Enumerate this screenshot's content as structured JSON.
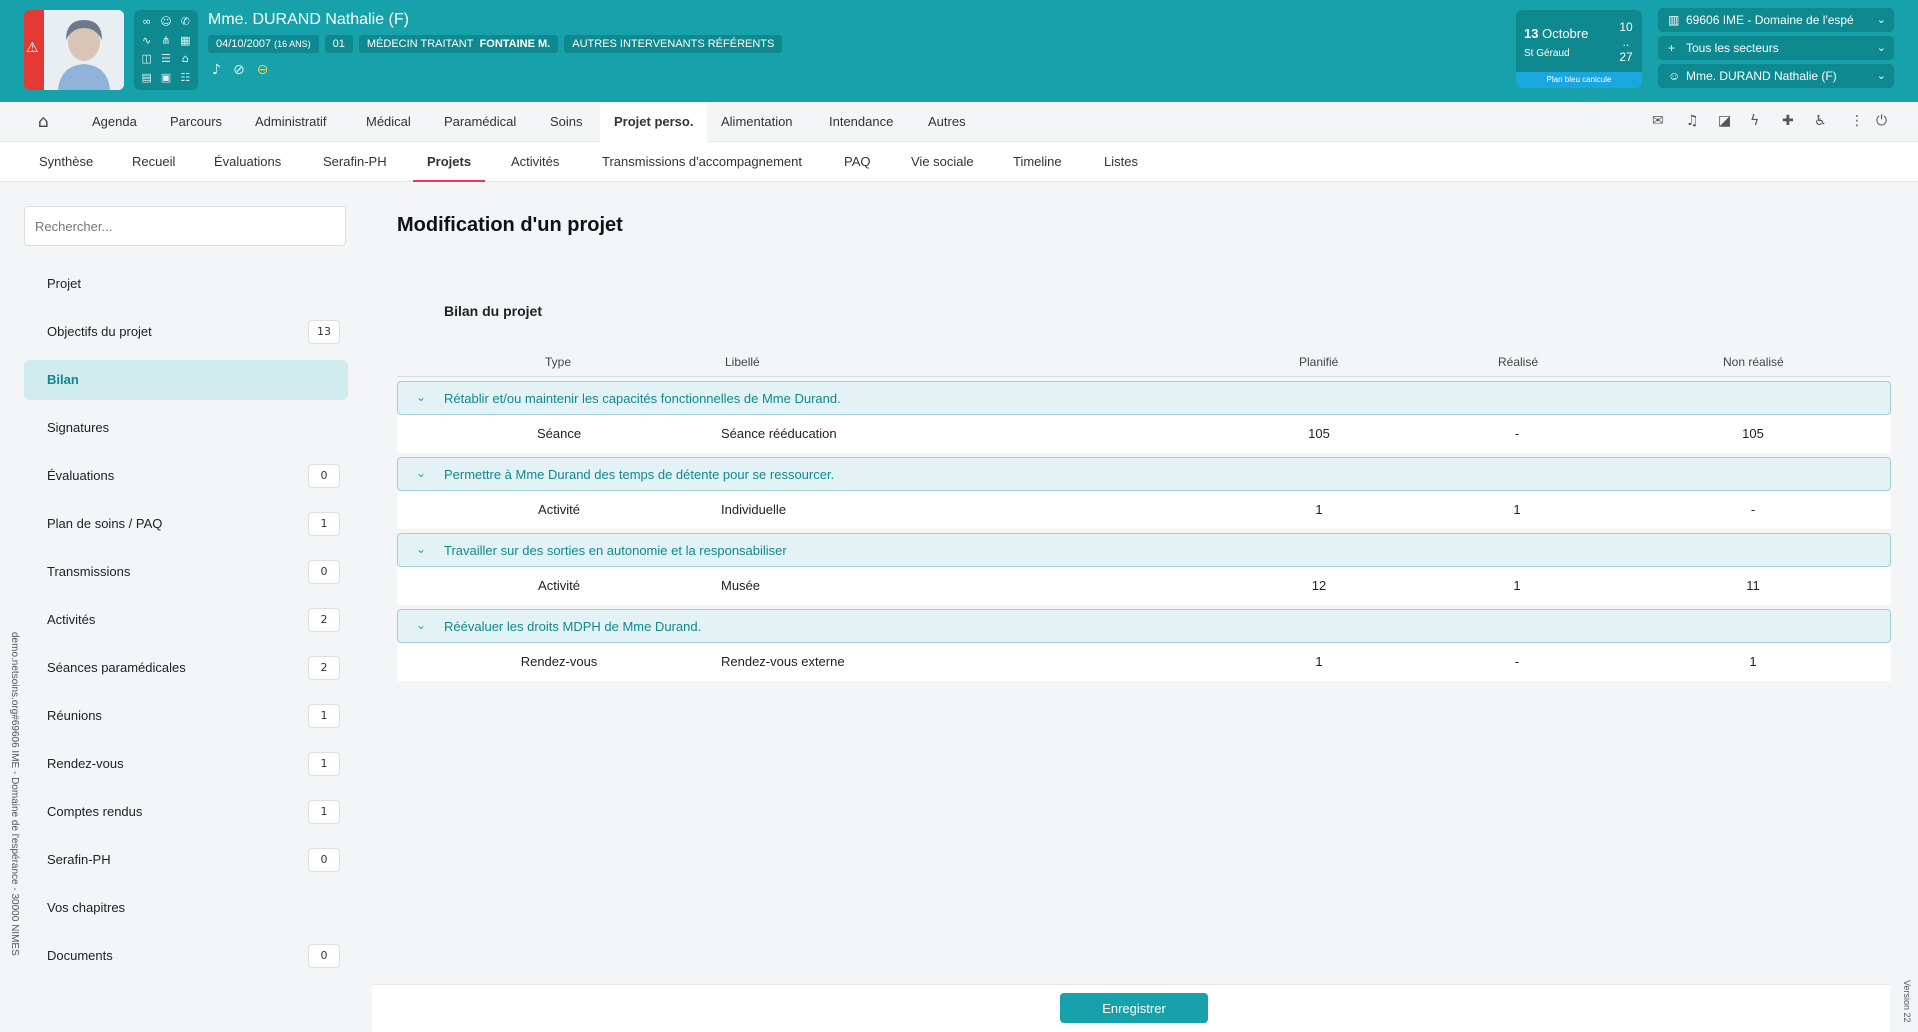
{
  "header": {
    "patient_name": "Mme. DURAND Nathalie (F)",
    "birth_date": "04/10/2007",
    "age": "(16 ANS)",
    "code": "01",
    "doctor_label": "MÉDECIN TRAITANT",
    "doctor_name": "FONTAINE M.",
    "others_label": "AUTRES INTERVENANTS RÉFÉRENTS",
    "date_day": "13",
    "date_month": "Octobre",
    "saint": "St Géraud",
    "side_top": "10",
    "side_dots": "..",
    "side_bottom": "27",
    "canicule": "Plan bleu canicule",
    "establishment": "69606  IME - Domaine de l'espé",
    "sectors": "Tous les secteurs",
    "user": "Mme. DURAND Nathalie (F)"
  },
  "nav_main": [
    "Agenda",
    "Parcours",
    "Administratif",
    "Médical",
    "Paramédical",
    "Soins",
    "Projet perso.",
    "Alimentation",
    "Intendance",
    "Autres"
  ],
  "nav_sub": [
    "Synthèse",
    "Recueil",
    "Évaluations",
    "Serafin-PH",
    "Projets",
    "Activités",
    "Transmissions d'accompagnement",
    "PAQ",
    "Vie sociale",
    "Timeline",
    "Listes"
  ],
  "sidebar": {
    "search_placeholder": "Rechercher...",
    "items": [
      {
        "label": "Projet",
        "badge": ""
      },
      {
        "label": "Objectifs du projet",
        "badge": "13"
      },
      {
        "label": "Bilan",
        "badge": ""
      },
      {
        "label": "Signatures",
        "badge": ""
      },
      {
        "label": "Évaluations",
        "badge": "0"
      },
      {
        "label": "Plan de soins / PAQ",
        "badge": "1"
      },
      {
        "label": "Transmissions",
        "badge": "0"
      },
      {
        "label": "Activités",
        "badge": "2"
      },
      {
        "label": "Séances paramédicales",
        "badge": "2"
      },
      {
        "label": "Réunions",
        "badge": "1"
      },
      {
        "label": "Rendez-vous",
        "badge": "1"
      },
      {
        "label": "Comptes rendus",
        "badge": "1"
      },
      {
        "label": "Serafin-PH",
        "badge": "0"
      },
      {
        "label": "Vos chapitres",
        "badge": ""
      },
      {
        "label": "Documents",
        "badge": "0"
      }
    ],
    "url": "demo.netsoins.org#69606 IME - Domaine de l'espérance - 30000 NIMES"
  },
  "main": {
    "title": "Modification d'un projet",
    "section": "Bilan du projet",
    "columns": {
      "type": "Type",
      "label": "Libellé",
      "planned": "Planifié",
      "done": "Réalisé",
      "not_done": "Non réalisé"
    },
    "groups": [
      {
        "title": "Rétablir et/ou maintenir les capacités fonctionnelles de Mme Durand.",
        "type": "Séance",
        "label": "Séance rééducation",
        "planned": "105",
        "done": "-",
        "not_done": "105"
      },
      {
        "title": "Permettre à Mme Durand des temps de détente pour se ressourcer.",
        "type": "Activité",
        "label": "Individuelle",
        "planned": "1",
        "done": "1",
        "not_done": "-"
      },
      {
        "title": "Travailler sur des sorties en autonomie et la responsabiliser",
        "type": "Activité",
        "label": "Musée",
        "planned": "12",
        "done": "1",
        "not_done": "11"
      },
      {
        "title": "Réévaluer les droits MDPH de Mme Durand.",
        "type": "Rendez-vous",
        "label": "Rendez-vous externe",
        "planned": "1",
        "done": "-",
        "not_done": "1"
      }
    ],
    "save_label": "Enregistrer",
    "version": "Version 22"
  }
}
